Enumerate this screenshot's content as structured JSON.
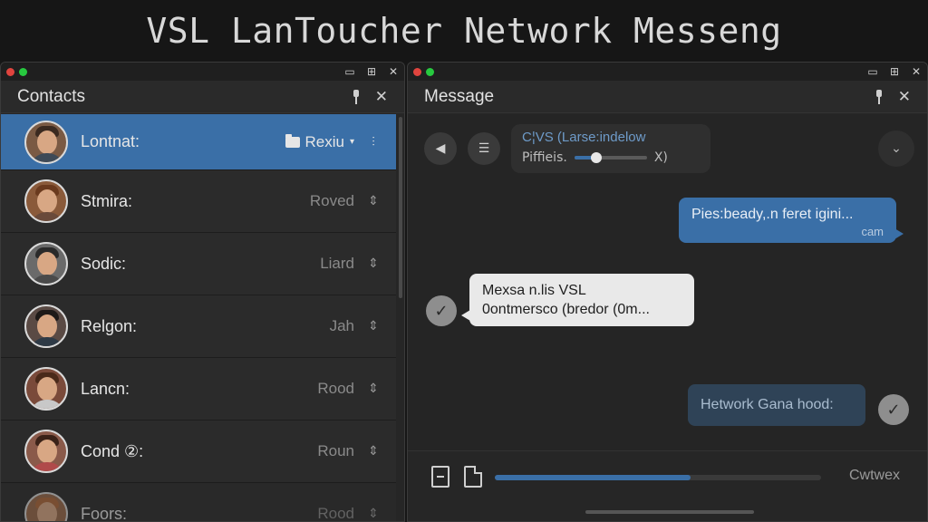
{
  "app": {
    "title": "VSL LanToucher Network Messeng"
  },
  "window_controls": {
    "minimize": "▭",
    "maximize": "⊞",
    "close": "✕"
  },
  "contacts_pane": {
    "title": "Contacts",
    "close_label": "✕",
    "items": [
      {
        "name": "Lontnat:",
        "status": "Rexiu",
        "caret": "▾",
        "action": "⫶",
        "selected": true,
        "avatar_color": "#7a5a44"
      },
      {
        "name": "Stmira:",
        "status": "Roved",
        "action": "⇕",
        "selected": false,
        "avatar_color": "#8a5a3a"
      },
      {
        "name": "Sodic:",
        "status": "Liard",
        "action": "⇕",
        "selected": false,
        "avatar_color": "#6a6a6a"
      },
      {
        "name": "Relgon:",
        "status": "Jah",
        "action": "⇕",
        "selected": false,
        "avatar_color": "#5a4a44"
      },
      {
        "name": "Lancn:",
        "status": "Rood",
        "action": "⇕",
        "selected": false,
        "avatar_color": "#7a4a3a"
      },
      {
        "name": "Cond ②:",
        "status": "Roun",
        "action": "⇕",
        "selected": false,
        "avatar_color": "#8a5a4a"
      },
      {
        "name": "Foors:",
        "status": "Rood",
        "action": "⇕",
        "selected": false,
        "avatar_color": "#9a6a4a"
      }
    ]
  },
  "message_pane": {
    "title": "Message",
    "close_label": "✕",
    "toolbar": {
      "back_icon": "◀",
      "wave_icon": "☰",
      "player_title": "C¦VS (Larse:indelow",
      "player_label": "Piffieis.",
      "player_extra": "X)",
      "player_level": 0.3,
      "more_icon": "⌄"
    },
    "messages": [
      {
        "direction": "out",
        "text": "Pies:beady,.n feret igini...",
        "meta": "cam"
      },
      {
        "direction": "in",
        "line1": "Mexsa n.lis VSL",
        "line2": "0ontmersco (bredor (0m..."
      },
      {
        "direction": "out",
        "text": "Hetwork Gana hood:"
      }
    ],
    "check_icon": "✓"
  },
  "composer": {
    "progress": 0.6,
    "label": "Cwtwex"
  },
  "colors": {
    "accent": "#3a6fa7",
    "background": "#262626"
  }
}
